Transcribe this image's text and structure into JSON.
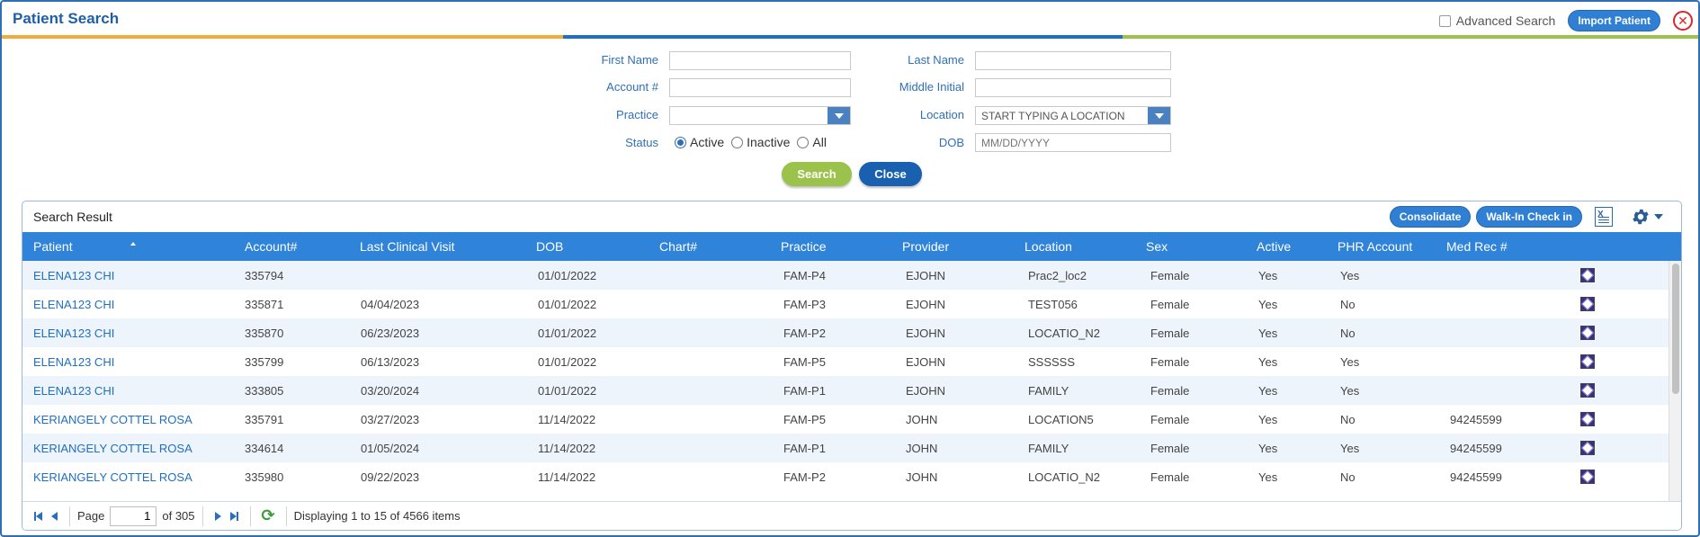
{
  "window": {
    "title": "Patient Search",
    "advanced_search_label": "Advanced Search",
    "import_label": "Import Patient"
  },
  "form": {
    "first_name_label": "First Name",
    "last_name_label": "Last Name",
    "account_label": "Account #",
    "middle_initial_label": "Middle Initial",
    "practice_label": "Practice",
    "location_label": "Location",
    "location_placeholder": "START TYPING A LOCATION",
    "status_label": "Status",
    "status_options": [
      "Active",
      "Inactive",
      "All"
    ],
    "status_selected": "Active",
    "dob_label": "DOB",
    "dob_placeholder": "MM/DD/YYYY",
    "search_label": "Search",
    "close_label": "Close"
  },
  "results": {
    "title": "Search Result",
    "consolidate_label": "Consolidate",
    "walkin_label": "Walk-In Check in",
    "columns": [
      "Patient",
      "Account#",
      "Last Clinical Visit",
      "DOB",
      "Chart#",
      "Practice",
      "Provider",
      "Location",
      "Sex",
      "Active",
      "PHR Account",
      "Med Rec #"
    ],
    "rows": [
      [
        "ELENA123 CHI",
        "335794",
        "",
        "01/01/2022",
        "",
        "FAM-P4",
        "EJOHN",
        "Prac2_loc2",
        "Female",
        "Yes",
        "Yes",
        ""
      ],
      [
        "ELENA123 CHI",
        "335871",
        "04/04/2023",
        "01/01/2022",
        "",
        "FAM-P3",
        "EJOHN",
        "TEST056",
        "Female",
        "Yes",
        "No",
        ""
      ],
      [
        "ELENA123 CHI",
        "335870",
        "06/23/2023",
        "01/01/2022",
        "",
        "FAM-P2",
        "EJOHN",
        "LOCATIO_N2",
        "Female",
        "Yes",
        "No",
        ""
      ],
      [
        "ELENA123 CHI",
        "335799",
        "06/13/2023",
        "01/01/2022",
        "",
        "FAM-P5",
        "EJOHN",
        "SSSSSS",
        "Female",
        "Yes",
        "Yes",
        ""
      ],
      [
        "ELENA123 CHI",
        "333805",
        "03/20/2024",
        "01/01/2022",
        "",
        "FAM-P1",
        "EJOHN",
        "FAMILY",
        "Female",
        "Yes",
        "Yes",
        ""
      ],
      [
        "KERIANGELY COTTEL ROSA",
        "335791",
        "03/27/2023",
        "11/14/2022",
        "",
        "FAM-P5",
        "JOHN",
        "LOCATION5",
        "Female",
        "Yes",
        "No",
        "94245599"
      ],
      [
        "KERIANGELY COTTEL ROSA",
        "334614",
        "01/05/2024",
        "11/14/2022",
        "",
        "FAM-P1",
        "JOHN",
        "FAMILY",
        "Female",
        "Yes",
        "Yes",
        "94245599"
      ],
      [
        "KERIANGELY COTTEL ROSA",
        "335980",
        "09/22/2023",
        "11/14/2022",
        "",
        "FAM-P2",
        "JOHN",
        "LOCATIO_N2",
        "Female",
        "Yes",
        "No",
        "94245599"
      ]
    ]
  },
  "pager": {
    "page_label": "Page",
    "page_value": "1",
    "of_label": "of 305",
    "display_text": "Displaying 1 to 15 of 4566 items"
  },
  "colors": {
    "brand_blue": "#1f5fa8",
    "header_blue": "#2f83d9",
    "green": "#9bc24a",
    "orange": "#f0ad3d",
    "close_red": "#d8262d"
  }
}
